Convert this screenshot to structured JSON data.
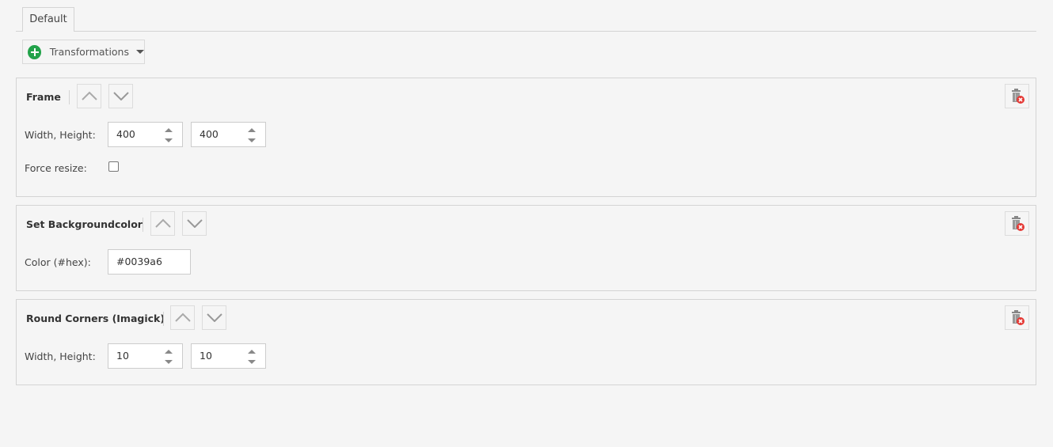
{
  "tabs": [
    {
      "label": "Default",
      "active": true
    }
  ],
  "add_button": {
    "label": "Transformations",
    "icon": "plus-circle-icon",
    "dropdown_icon": "caret-down-icon"
  },
  "panels": [
    {
      "title": "Frame",
      "move_up_icon": "chevron-up-icon",
      "move_down_icon": "chevron-down-icon",
      "delete_icon": "trash-delete-icon",
      "fields": {
        "size_label": "Width, Height:",
        "width": "400",
        "height": "400",
        "force_resize_label": "Force resize:",
        "force_resize_checked": false
      }
    },
    {
      "title": "Set Backgroundcolor",
      "move_up_icon": "chevron-up-icon",
      "move_down_icon": "chevron-down-icon",
      "delete_icon": "trash-delete-icon",
      "fields": {
        "color_label": "Color (#hex):",
        "color": "#0039a6"
      }
    },
    {
      "title": "Round Corners (Imagick)",
      "move_up_icon": "chevron-up-icon",
      "move_down_icon": "chevron-down-icon",
      "delete_icon": "trash-delete-icon",
      "fields": {
        "size_label": "Width, Height:",
        "width": "10",
        "height": "10"
      }
    }
  ],
  "colors": {
    "add_green": "#22a24a",
    "delete_red": "#e53935",
    "border": "#d4d4d4",
    "background": "#f5f5f5"
  }
}
